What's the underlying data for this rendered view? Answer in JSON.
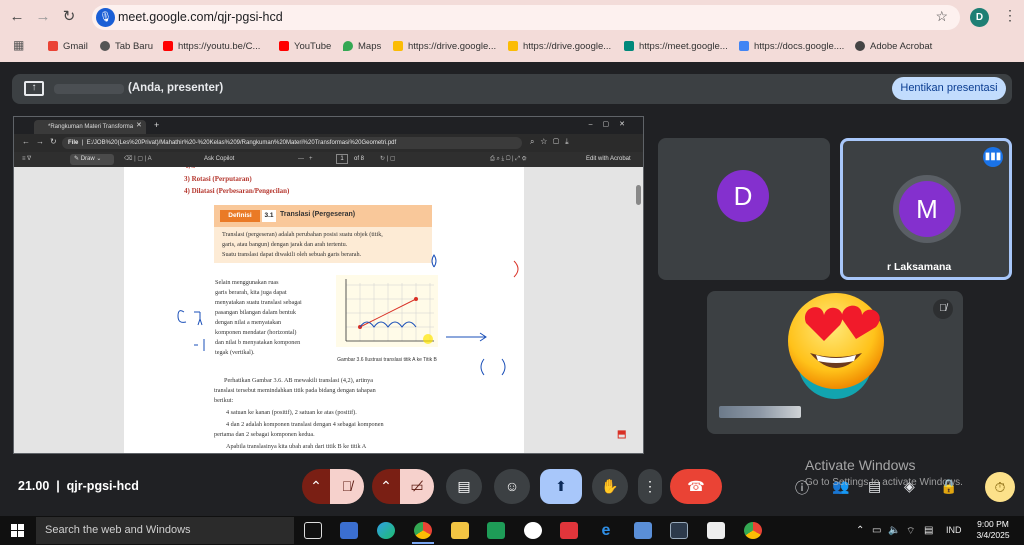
{
  "browser": {
    "url": "meet.google.com/qjr-pgsi-hcd",
    "profile_initial": "D",
    "bookmarks": [
      {
        "label": "Gmail",
        "color": "#ea4335"
      },
      {
        "label": "Tab Baru",
        "color": "#555555"
      },
      {
        "label": "https://youtu.be/C...",
        "color": "#ff0000"
      },
      {
        "label": "YouTube",
        "color": "#ff0000"
      },
      {
        "label": "Maps",
        "color": "#34a853"
      },
      {
        "label": "https://drive.google...",
        "color": "#fbbc04"
      },
      {
        "label": "https://drive.google...",
        "color": "#fbbc04"
      },
      {
        "label": "https://meet.google...",
        "color": "#00897b"
      },
      {
        "label": "https://docs.google....",
        "color": "#4285f4"
      },
      {
        "label": "Adobe Acrobat",
        "color": "#444444"
      }
    ]
  },
  "meet": {
    "presenter_text": "(Anda, presenter)",
    "stop_button": "Hentikan presentasi",
    "time": "21.00",
    "meeting_code": "qjr-pgsi-hcd",
    "activate_title": "Activate Windows",
    "activate_sub": "Go to Settings to activate Windows.",
    "participants": [
      {
        "initial": "D",
        "color": "#8430ce"
      },
      {
        "initial": "M",
        "color": "#8430ce",
        "name": "r Laksamana"
      },
      {
        "initial": "D",
        "color": "#12a4af"
      }
    ]
  },
  "shared": {
    "tab_title": "*Rangkuman Materi Transforma",
    "file_label": "File",
    "path": "E:/JOB%20(Les%20Privat)/Mahathir%20-%20Kelas%209/Rangkuman%20Materi%20Transformasi%20Geometri.pdf",
    "draw_label": "Draw",
    "copilot_label": "Ask Copilot",
    "page_current": "1",
    "page_of": "of 8",
    "edit_label": "Edit with Acrobat",
    "list": [
      "3)  Rotasi (Perputaran)",
      "4)  Dilatasi (Perbesaran/Pengecilan)"
    ],
    "def_label": "Definisi",
    "def_num": "3.1",
    "def_title": "Translasi (Pergeseran)",
    "def_lines": [
      "Translasi (pergeseran) adalah perubahan posisi suatu objek (titik,",
      "garis, atau bangun) dengan jarak dan arah tertentu.",
      "Suatu translasi dapat diwakili oleh sebuah garis berarah."
    ],
    "body_left": [
      "Selain      menggunakan      ruas",
      "garis   berarah,   kita   juga   dapat",
      "menyatakan suatu translasi sebagai",
      "pasangan   bilangan   dalam   bentuk",
      "       dengan  nilai  a  menyatakan",
      "komponen   mendatar   (horizontal)",
      "dan nilai  b  menyatakan komponen",
      "tegak (vertikal)."
    ],
    "figure_caption": "Gambar 3.6 Ilustrasi translasi titik A ke Titik B",
    "body_bottom": [
      "Perhatikan  Gambar  3.6.  AB  mewakili  translasi  (4,2),  artinya",
      "translasi  tersebut  memindahkan  titik  pada  bidang  dengan  tahapan",
      "berikut:",
      "4 satuan ke kanan (positif), 2 satuan ke atas (positif).",
      "4 dan 2 adalah komponen translasi dengan 4 sebagai komponen",
      "pertama dan 2 sebagai komponen kedua.",
      "Apabila translasinya kita ubah arah dari titik B ke titik A"
    ]
  },
  "taskbar": {
    "search_placeholder": "Search the web and Windows",
    "lang": "IND",
    "clock_time": "9:00 PM",
    "clock_date": "3/4/2025"
  }
}
